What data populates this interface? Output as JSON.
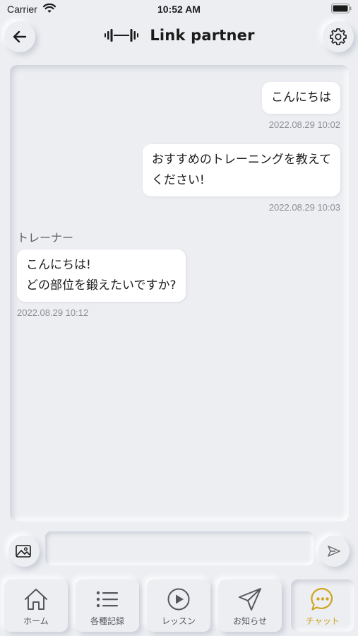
{
  "status_bar": {
    "carrier": "Carrier",
    "time": "10:52 AM"
  },
  "header": {
    "title": "Link partner",
    "logo_icon": "dumbbell-sound-icon"
  },
  "messages": [
    {
      "side": "right",
      "text": "こんにちは",
      "time": "2022.08.29 10:02"
    },
    {
      "side": "right",
      "text": "おすすめのトレーニングを教えて\nください!",
      "time": "2022.08.29 10:03"
    },
    {
      "side": "left",
      "sender": "トレーナー",
      "text": "こんにちは!\nどの部位を鍛えたいですか?",
      "time": "2022.08.29 10:12"
    }
  ],
  "input": {
    "value": "",
    "placeholder": ""
  },
  "tabs": [
    {
      "label": "ホーム",
      "icon": "home-icon"
    },
    {
      "label": "各種記録",
      "icon": "list-icon"
    },
    {
      "label": "レッスン",
      "icon": "play-icon"
    },
    {
      "label": "お知らせ",
      "icon": "paper-plane-icon"
    },
    {
      "label": "チャット",
      "icon": "chat-icon",
      "active": true
    }
  ],
  "colors": {
    "background": "#eceef2",
    "accent": "#d0a520",
    "bubble": "#ffffff",
    "timestamp": "#8b8e96"
  }
}
